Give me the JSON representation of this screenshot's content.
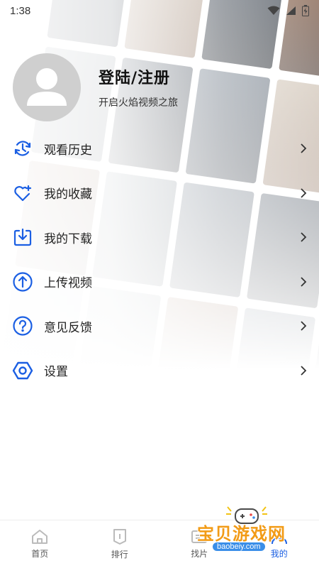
{
  "status_bar": {
    "time": "1:38",
    "icons": [
      "wifi-icon",
      "signal-icon",
      "battery-icon"
    ]
  },
  "profile": {
    "title": "登陆/注册",
    "subtitle": "开启火焰视频之旅",
    "avatar_icon": "user-avatar-icon"
  },
  "menu": {
    "items": [
      {
        "label": "观看历史",
        "icon": "history-icon"
      },
      {
        "label": "我的收藏",
        "icon": "heart-plus-icon"
      },
      {
        "label": "我的下载",
        "icon": "download-icon"
      },
      {
        "label": "上传视频",
        "icon": "upload-icon"
      },
      {
        "label": "意见反馈",
        "icon": "question-icon"
      },
      {
        "label": "设置",
        "icon": "settings-icon"
      }
    ]
  },
  "bottom_nav": {
    "items": [
      {
        "label": "首页",
        "icon": "home-icon"
      },
      {
        "label": "排行",
        "icon": "ranking-icon"
      },
      {
        "label": "找片",
        "icon": "find-icon"
      },
      {
        "label": "我的",
        "icon": "profile-icon",
        "active": true
      }
    ]
  },
  "watermark": {
    "text": "宝贝游戏网",
    "url": "baobeiy.com"
  },
  "colors": {
    "accent": "#1b5fe3",
    "avatar_bg": "#cfcfcf",
    "watermark_orange": "#f29b16"
  }
}
